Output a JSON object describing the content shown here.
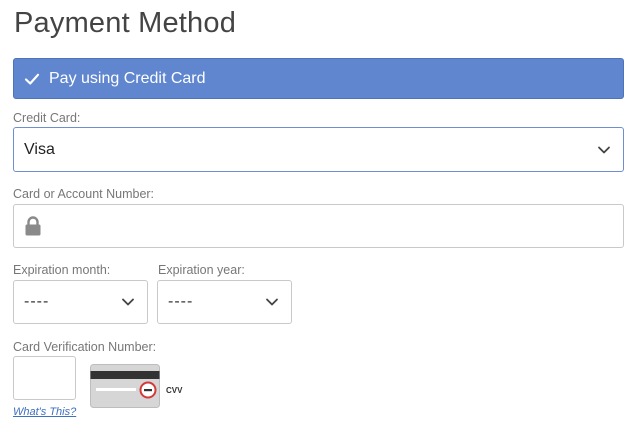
{
  "page": {
    "title": "Payment Method"
  },
  "banner": {
    "label": "Pay using Credit Card",
    "icon": "check-icon",
    "color": "#5f86cf"
  },
  "credit_card": {
    "label": "Credit Card:",
    "selected": "Visa"
  },
  "account_number": {
    "label": "Card or Account Number:",
    "value": "",
    "icon": "lock-icon"
  },
  "expiration_month": {
    "label": "Expiration month:",
    "selected": "----"
  },
  "expiration_year": {
    "label": "Expiration year:",
    "selected": "----"
  },
  "cvv": {
    "label": "Card Verification Number:",
    "value": "",
    "badge": "CVV",
    "help_link": "What's This?"
  }
}
